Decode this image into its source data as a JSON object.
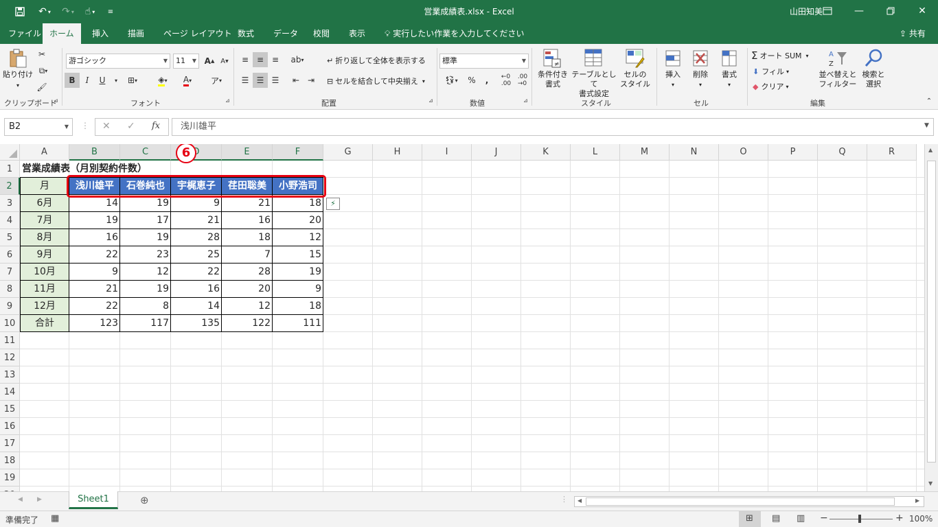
{
  "app": {
    "title": "営業成績表.xlsx  -  Excel",
    "user": "山田知美",
    "share_label": "共有",
    "tell_me": "実行したい作業を入力してください"
  },
  "tabs": [
    "ファイル",
    "ホーム",
    "挿入",
    "描画",
    "ページ レイアウト",
    "数式",
    "データ",
    "校閲",
    "表示"
  ],
  "active_tab": "ホーム",
  "ribbon": {
    "clipboard": {
      "label": "クリップボード",
      "paste": "貼り付け"
    },
    "font": {
      "label": "フォント",
      "name": "游ゴシック",
      "size": "11",
      "bold": "B",
      "italic": "I",
      "underline": "U",
      "grow": "A",
      "shrink": "A",
      "font_color": "A",
      "phonetic": "ア"
    },
    "alignment": {
      "label": "配置",
      "wrap": "折り返して全体を表示する",
      "merge": "セルを結合して中央揃え"
    },
    "number": {
      "label": "数値",
      "format": "標準",
      "percent": "%",
      "comma": ","
    },
    "styles": {
      "label": "スタイル",
      "conditional": "条件付き\n書式",
      "table": "テーブルとして\n書式設定",
      "cell_styles": "セルの\nスタイル"
    },
    "cells": {
      "label": "セル",
      "insert": "挿入",
      "delete": "削除",
      "format": "書式"
    },
    "editing": {
      "label": "編集",
      "autosum": "オート SUM",
      "fill": "フィル",
      "clear": "クリア",
      "sort": "並べ替えと\nフィルター",
      "find": "検索と\n選択"
    }
  },
  "formula_bar": {
    "name_box": "B2",
    "fx": "fx",
    "value": "浅川雄平"
  },
  "columns": [
    "A",
    "B",
    "C",
    "D",
    "E",
    "F",
    "G",
    "H",
    "I",
    "J",
    "K",
    "L",
    "M",
    "N",
    "O",
    "P",
    "Q",
    "R"
  ],
  "rows": [
    "1",
    "2",
    "3",
    "4",
    "5",
    "6",
    "7",
    "8",
    "9",
    "10",
    "11",
    "12",
    "13",
    "14",
    "15",
    "16",
    "17",
    "18",
    "19",
    "20"
  ],
  "sheet": {
    "title": "営業成績表（月別契約件数）",
    "header_first": "月",
    "names": [
      "浅川雄平",
      "石巻純也",
      "宇梶恵子",
      "荏田聡美",
      "小野浩司"
    ],
    "data_rows": [
      {
        "month": "6月",
        "values": [
          "14",
          "19",
          "9",
          "21",
          "18"
        ]
      },
      {
        "month": "7月",
        "values": [
          "19",
          "17",
          "21",
          "16",
          "20"
        ]
      },
      {
        "month": "8月",
        "values": [
          "16",
          "19",
          "28",
          "18",
          "12"
        ]
      },
      {
        "month": "9月",
        "values": [
          "22",
          "23",
          "25",
          "7",
          "15"
        ]
      },
      {
        "month": "10月",
        "values": [
          "9",
          "12",
          "22",
          "28",
          "19"
        ]
      },
      {
        "month": "11月",
        "values": [
          "21",
          "19",
          "16",
          "20",
          "9"
        ]
      },
      {
        "month": "12月",
        "values": [
          "22",
          "8",
          "14",
          "12",
          "18"
        ]
      },
      {
        "month": "合計",
        "values": [
          "123",
          "117",
          "135",
          "122",
          "111"
        ]
      }
    ]
  },
  "annotation": {
    "step": "6",
    "highlight_color": "#e60012"
  },
  "colors": {
    "excel_green": "#217346",
    "header_blue": "#4472c4",
    "month_green": "#e2efda"
  },
  "sheet_tabs": [
    "Sheet1"
  ],
  "status": {
    "ready": "準備完了",
    "zoom": "100%"
  }
}
